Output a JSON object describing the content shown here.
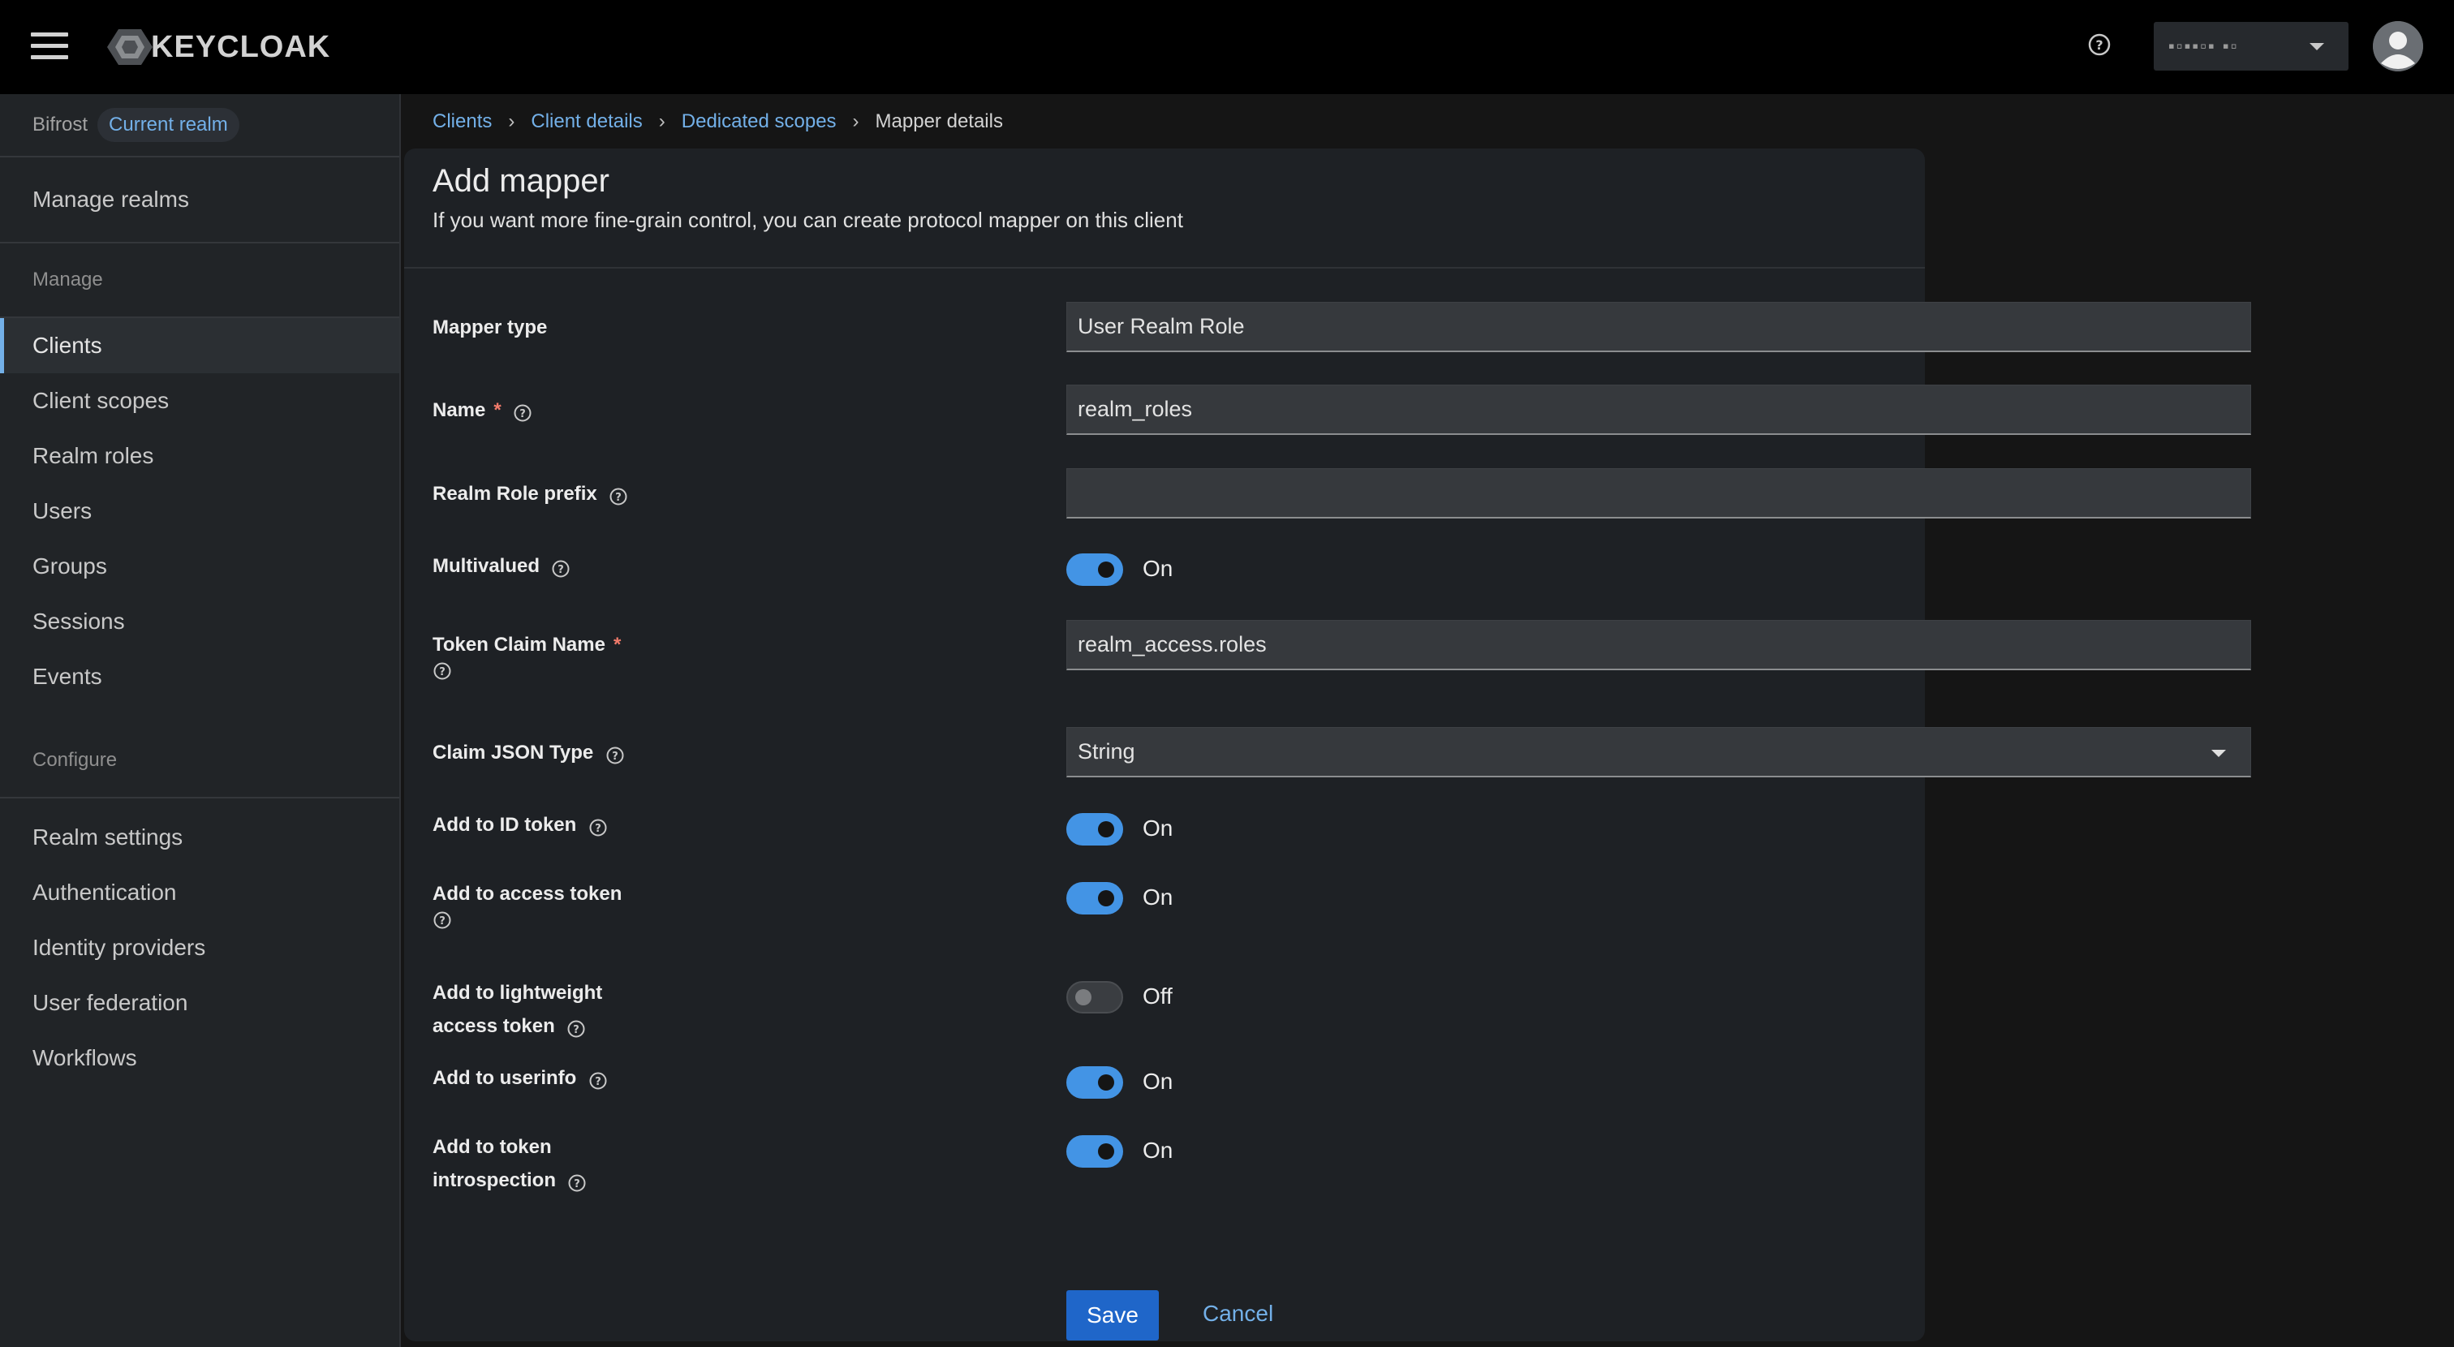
{
  "app": {
    "logo_text": "KEYCLOAK"
  },
  "header": {
    "user_name": "▪▫▪▪▫▪ ▪▫",
    "icons": [
      "hamburger-icon",
      "keycloak-logo-icon",
      "help-icon",
      "caret-down-icon",
      "avatar-icon"
    ]
  },
  "sidebar": {
    "realm_name": "Bifrost",
    "realm_badge": "Current realm",
    "manage_realms": "Manage realms",
    "manage_section": "Manage",
    "manage_items": [
      "Clients",
      "Client scopes",
      "Realm roles",
      "Users",
      "Groups",
      "Sessions",
      "Events"
    ],
    "configure_section": "Configure",
    "configure_items": [
      "Realm settings",
      "Authentication",
      "Identity providers",
      "User federation",
      "Workflows"
    ],
    "active_item": "Clients"
  },
  "breadcrumb": [
    "Clients",
    "Client details",
    "Dedicated scopes",
    "Mapper details"
  ],
  "page": {
    "title": "Add mapper",
    "subtitle": "If you want more fine-grain control, you can create protocol mapper on this client"
  },
  "form": {
    "mapper_type": {
      "label": "Mapper type",
      "value": "User Realm Role"
    },
    "name": {
      "label": "Name",
      "value": "realm_roles",
      "required": "*"
    },
    "realm_role_prefix": {
      "label": "Realm Role prefix",
      "value": ""
    },
    "multivalued": {
      "label": "Multivalued",
      "state": "On"
    },
    "token_claim_name": {
      "label": "Token Claim Name",
      "value": "realm_access.roles",
      "required": "*"
    },
    "claim_json_type": {
      "label": "Claim JSON Type",
      "value": "String"
    },
    "add_to_id_token": {
      "label": "Add to ID token",
      "state": "On"
    },
    "add_to_access_token": {
      "label": "Add to access token",
      "state": "On"
    },
    "add_to_lightweight": {
      "label_line1": "Add to lightweight",
      "label_line2": "access token",
      "state": "Off"
    },
    "add_to_userinfo": {
      "label": "Add to userinfo",
      "state": "On"
    },
    "add_to_introspection": {
      "label_line1": "Add to token",
      "label_line2": "introspection",
      "state": "On"
    }
  },
  "actions": {
    "save": "Save",
    "cancel": "Cancel"
  },
  "colors": {
    "accent": "#73b0e8",
    "toggle_on": "#4394e5",
    "primary_button": "#1f66c9",
    "required": "#f27b6b"
  }
}
